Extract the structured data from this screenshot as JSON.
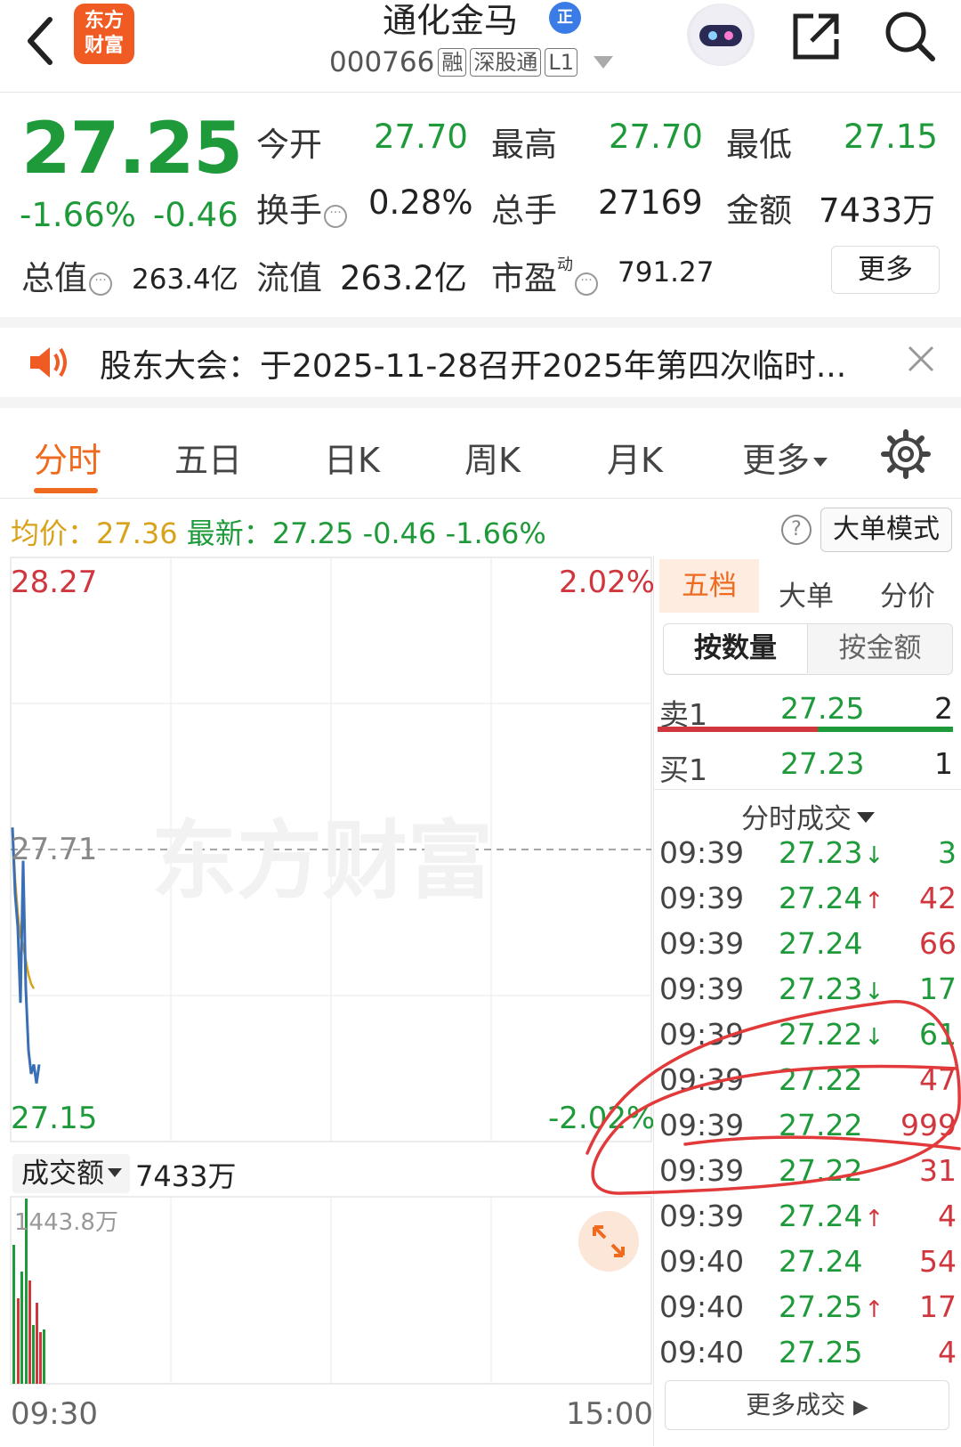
{
  "header": {
    "logo_text_1": "东方",
    "logo_text_2": "财富",
    "stock_name": "通化金马",
    "badge": "正",
    "code": "000766",
    "tags": [
      "融",
      "深股通",
      "L1"
    ]
  },
  "quote": {
    "price": "27.25",
    "change_pct": "-1.66%",
    "change": "-0.46",
    "stats": [
      {
        "label": "今开",
        "value": "27.70"
      },
      {
        "label": "最高",
        "value": "27.70"
      },
      {
        "label": "最低",
        "value": "27.15"
      },
      {
        "label": "换手",
        "value": "0.28%"
      },
      {
        "label": "总手",
        "value": "27169"
      },
      {
        "label": "金额",
        "value": "7433万"
      },
      {
        "label": "总值",
        "value": "263.4亿"
      },
      {
        "label": "流值",
        "value": "263.2亿"
      },
      {
        "label": "市盈",
        "value": "791.27"
      }
    ],
    "pe_superscript": "动",
    "more_label": "更多"
  },
  "notice": {
    "text": "股东大会：于2025-11-28召开2025年第四次临时..."
  },
  "tabs": [
    "分时",
    "五日",
    "日K",
    "周K",
    "月K",
    "更多"
  ],
  "avg_line": {
    "avg_label": "均价：",
    "avg_value": "27.36",
    "latest_label": "最新：",
    "latest_value": "27.25",
    "change": "-0.46",
    "change_pct": "-1.66%",
    "help": "?",
    "big_order_label": "大单模式"
  },
  "chart": {
    "y_high": "28.27",
    "y_low": "27.15",
    "pct_high": "2.02%",
    "pct_low": "-2.02%",
    "ref_price": "27.71",
    "watermark": "东方财富",
    "x_start": "09:30",
    "x_end": "15:00",
    "price_series": [
      27.7,
      27.56,
      27.49,
      27.33,
      27.63,
      27.36,
      27.23,
      27.18,
      27.2,
      27.16,
      27.2
    ],
    "avg_series": [
      27.7,
      27.59,
      27.52,
      27.47,
      27.45,
      27.42,
      27.39,
      27.37,
      27.36
    ]
  },
  "volume": {
    "selector": "成交额",
    "total": "7433万",
    "max_label": "1443.8万"
  },
  "right_panel": {
    "tabs": [
      "五档",
      "大单",
      "分价"
    ],
    "seg_on": "按数量",
    "seg_off": "按金额",
    "levels": [
      {
        "label": "卖1",
        "price": "27.25",
        "qty": "2"
      },
      {
        "label": "买1",
        "price": "27.23",
        "qty": "1"
      }
    ],
    "ticks_title": "分时成交",
    "trades": [
      {
        "time": "09:39",
        "price": "27.23",
        "dir": "↓",
        "vol": "3"
      },
      {
        "time": "09:39",
        "price": "27.24",
        "dir": "↑",
        "vol": "42"
      },
      {
        "time": "09:39",
        "price": "27.24",
        "dir": "",
        "vol": "66"
      },
      {
        "time": "09:39",
        "price": "27.23",
        "dir": "↓",
        "vol": "17"
      },
      {
        "time": "09:39",
        "price": "27.22",
        "dir": "↓",
        "vol": "61"
      },
      {
        "time": "09:39",
        "price": "27.22",
        "dir": "",
        "vol": "47"
      },
      {
        "time": "09:39",
        "price": "27.22",
        "dir": "",
        "vol": "999"
      },
      {
        "time": "09:39",
        "price": "27.22",
        "dir": "",
        "vol": "31"
      },
      {
        "time": "09:39",
        "price": "27.24",
        "dir": "↑",
        "vol": "4"
      },
      {
        "time": "09:40",
        "price": "27.24",
        "dir": "",
        "vol": "54"
      },
      {
        "time": "09:40",
        "price": "27.25",
        "dir": "↑",
        "vol": "17"
      },
      {
        "time": "09:40",
        "price": "27.25",
        "dir": "",
        "vol": "4"
      }
    ],
    "more_trades": "更多成交"
  },
  "colors": {
    "up": "#d0363d",
    "down": "#1e9a3a",
    "accent": "#ef6a1e",
    "avg": "#d9a21b",
    "price_line": "#3a6fb5"
  }
}
